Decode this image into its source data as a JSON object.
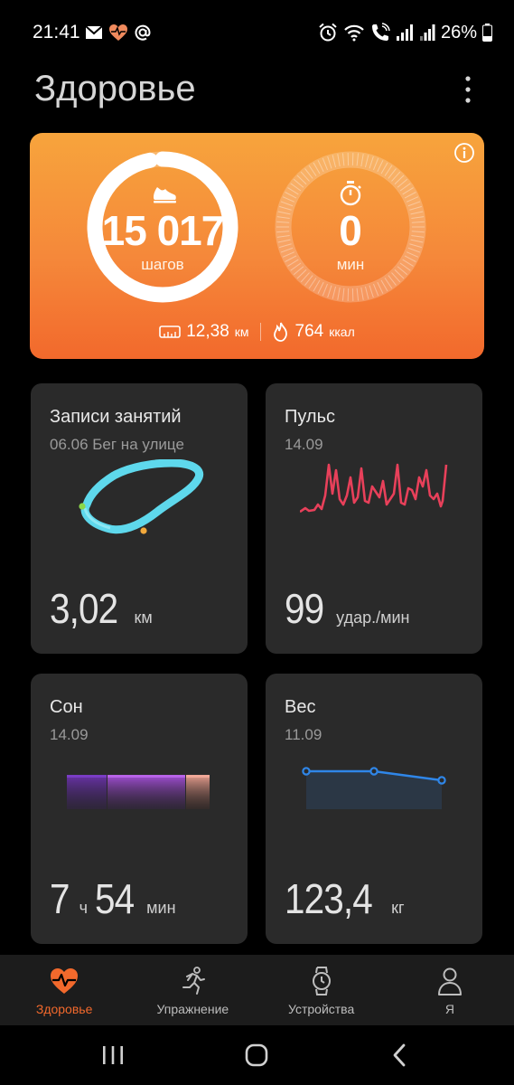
{
  "status": {
    "time": "21:41",
    "battery": "26%"
  },
  "header": {
    "title": "Здоровье"
  },
  "activity": {
    "steps_value": "15 017",
    "steps_unit": "шагов",
    "steps_progress": 0.97,
    "minutes_value": "0",
    "minutes_unit": "мин",
    "distance_value": "12,38",
    "distance_unit": "км",
    "calories_value": "764",
    "calories_unit": "ккал"
  },
  "tiles": {
    "activity": {
      "title": "Записи занятий",
      "subtitle": "06.06 Бег на улице",
      "value": "3,02",
      "unit": "км"
    },
    "pulse": {
      "title": "Пульс",
      "subtitle": "14.09",
      "value": "99",
      "unit": "удар./мин"
    },
    "sleep": {
      "title": "Сон",
      "subtitle": "14.09",
      "hours": "7",
      "hours_unit": "ч",
      "minutes": "54",
      "minutes_unit": "мин"
    },
    "weight": {
      "title": "Вес",
      "subtitle": "11.09",
      "value": "123,4",
      "unit": "кг",
      "points": [
        123.6,
        123.6,
        123.4
      ]
    }
  },
  "nav": {
    "items": [
      {
        "label": "Здоровье",
        "icon": "heart-pulse-icon",
        "active": true
      },
      {
        "label": "Упражнение",
        "icon": "running-icon",
        "active": false
      },
      {
        "label": "Устройства",
        "icon": "watch-icon",
        "active": false
      },
      {
        "label": "Я",
        "icon": "person-icon",
        "active": false
      }
    ]
  },
  "colors": {
    "accent": "#f2692c",
    "pulse": "#e8405a",
    "route": "#5ed8ec",
    "weight": "#2f86e8",
    "sleep_deep": "#5a2a8c",
    "sleep_light": "#9a4fcf",
    "sleep_awake": "#e08a7a"
  }
}
